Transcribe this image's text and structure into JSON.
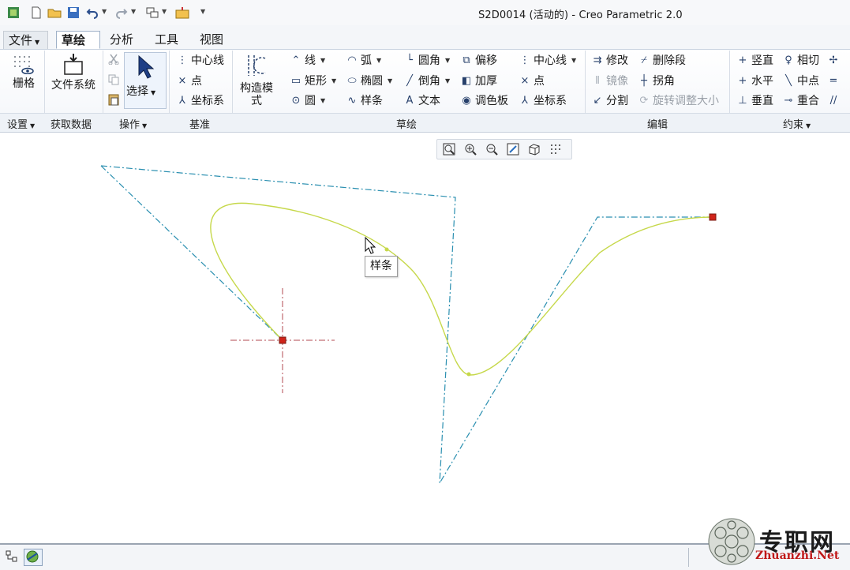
{
  "window": {
    "title": "S2D0014 (活动的) - Creo Parametric 2.0"
  },
  "tabs": [
    {
      "label": "文件"
    },
    {
      "label": "草绘"
    },
    {
      "label": "分析"
    },
    {
      "label": "工具"
    },
    {
      "label": "视图"
    }
  ],
  "ribbon": {
    "settings": {
      "grid": "栅格"
    },
    "get_data": {
      "file_system": "文件系统"
    },
    "operations": {
      "select": "选择"
    },
    "datum": {
      "centerline": "中心线",
      "point": "点",
      "csys": "坐标系"
    },
    "construction": {
      "label": "构造模式"
    },
    "sketch": {
      "line": "线",
      "rect": "矩形",
      "circle": "圆",
      "arc": "弧",
      "ellipse": "椭圆",
      "spline": "样条",
      "fillet": "圆角",
      "chamfer": "倒角",
      "text": "文本",
      "offset": "偏移",
      "thicken": "加厚",
      "palette": "调色板",
      "centerline": "中心线",
      "point": "点",
      "csys": "坐标系"
    },
    "editing": {
      "modify": "修改",
      "mirror": "镜像",
      "divide": "分割",
      "delete_segment": "删除段",
      "corner": "拐角",
      "rotate_resize": "旋转调整大小"
    },
    "constrain": {
      "vertical": "竖直",
      "horizontal": "水平",
      "perpendicular": "垂直",
      "tangent": "相切",
      "midpoint": "中点",
      "coincident": "重合"
    },
    "groups": {
      "settings": "设置",
      "get_data": "获取数据",
      "operations": "操作",
      "datum": "基准",
      "sketch": "草绘",
      "editing": "编辑",
      "constrain": "约束"
    }
  },
  "canvas": {
    "tooltip": "样条"
  },
  "colors": {
    "spline": "#c6d84a",
    "polygon": "#2a8fb0",
    "endpoint": "#d0241a"
  },
  "watermark": {
    "text": "专职网",
    "url": "Zhuanzhi.Net"
  }
}
